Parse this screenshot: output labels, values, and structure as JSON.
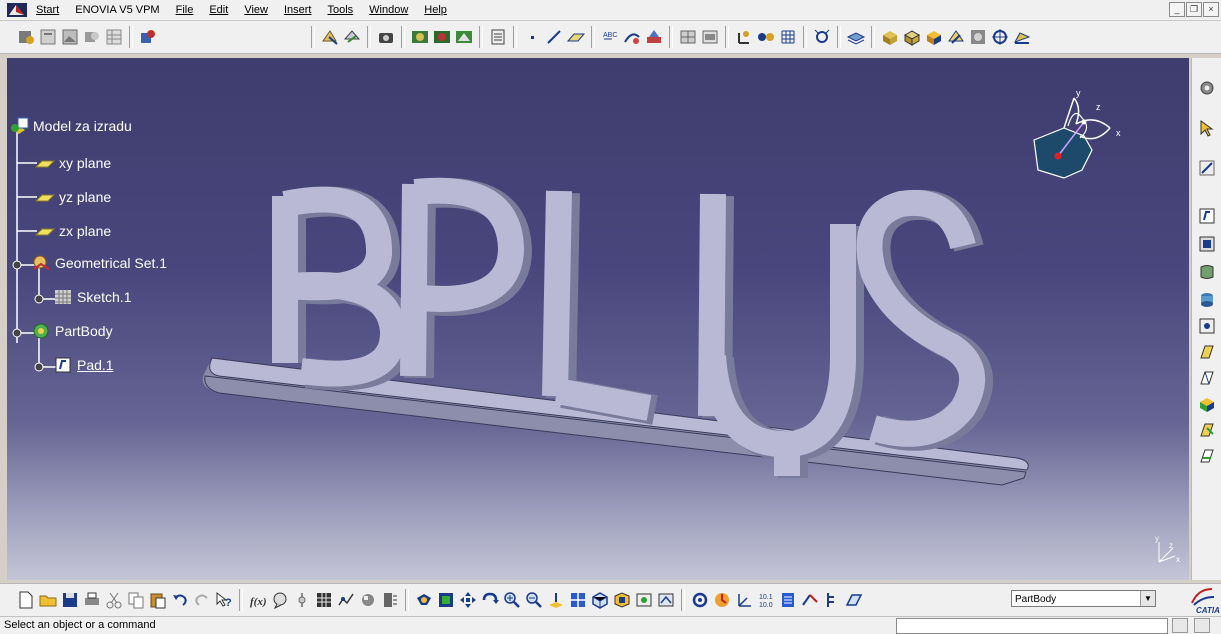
{
  "menubar": {
    "items": [
      {
        "label": "Start",
        "underline": true
      },
      {
        "label": "ENOVIA V5 VPM",
        "underline": false
      },
      {
        "label": "File",
        "underline": true
      },
      {
        "label": "Edit",
        "underline": true
      },
      {
        "label": "View",
        "underline": true
      },
      {
        "label": "Insert",
        "underline": true
      },
      {
        "label": "Tools",
        "underline": true
      },
      {
        "label": "Window",
        "underline": true
      },
      {
        "label": "Help",
        "underline": true
      }
    ]
  },
  "tree": {
    "root": "Model za izradu",
    "nodes": [
      {
        "label": "xy plane",
        "icon": "plane-icon"
      },
      {
        "label": "yz plane",
        "icon": "plane-icon"
      },
      {
        "label": "zx plane",
        "icon": "plane-icon"
      },
      {
        "label": "Geometrical Set.1",
        "icon": "geometrical-set-icon"
      },
      {
        "label": "Sketch.1",
        "icon": "sketch-icon"
      },
      {
        "label": "PartBody",
        "icon": "partbody-icon"
      },
      {
        "label": "Pad.1",
        "icon": "pad-icon"
      }
    ]
  },
  "compass": {
    "x": "x",
    "y": "y",
    "z": "z"
  },
  "axis": {
    "y": "y",
    "z": "z",
    "x": "x"
  },
  "model": {
    "text": "BPLUS"
  },
  "combo": {
    "value": "PartBody"
  },
  "status": {
    "text": "Select an object or a command"
  },
  "brand": {
    "label": "CATIA"
  },
  "colors": {
    "viewport_top": "#3f3c6e",
    "viewport_bottom": "#c4c5d6",
    "model_face": "#b9b9d6",
    "model_side": "#8a8aa8"
  }
}
